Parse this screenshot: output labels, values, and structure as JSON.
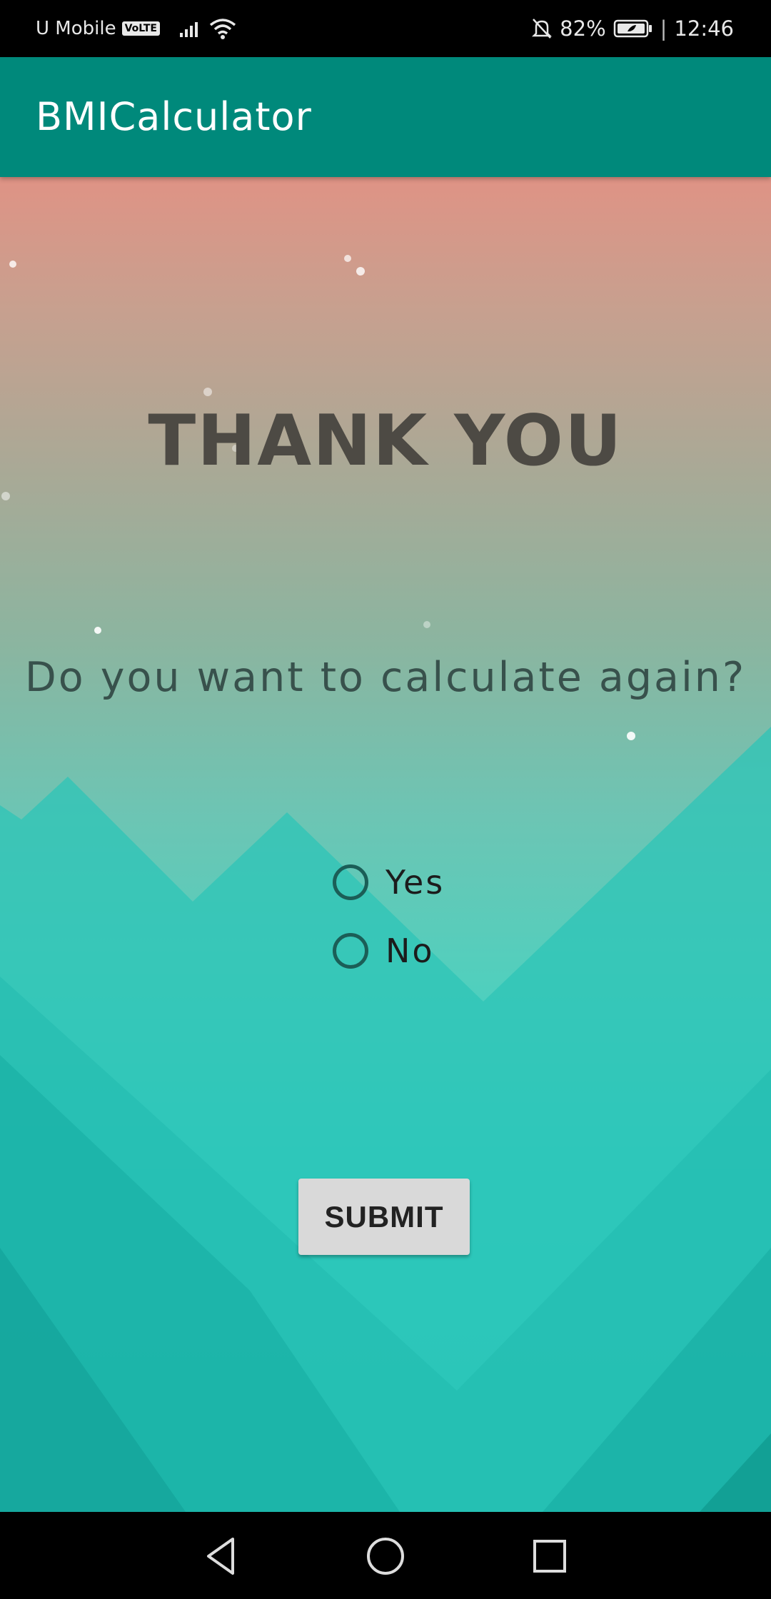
{
  "status_bar": {
    "carrier": "U Mobile",
    "network_badge": "VoLTE",
    "battery": "82%",
    "time": "12:46",
    "icons": [
      "signal-icon",
      "wifi-icon",
      "bell-off-icon",
      "battery-icon"
    ]
  },
  "app_bar": {
    "title": "BMICalculator",
    "color": "#00897b"
  },
  "main": {
    "heading": "THANK YOU",
    "question": "Do you want to calculate again?",
    "options": [
      {
        "label": "Yes",
        "checked": false
      },
      {
        "label": "No",
        "checked": false
      }
    ],
    "submit_label": "SUBMIT"
  },
  "nav_bar": {
    "icons": [
      "back-icon",
      "home-icon",
      "recents-icon"
    ]
  }
}
